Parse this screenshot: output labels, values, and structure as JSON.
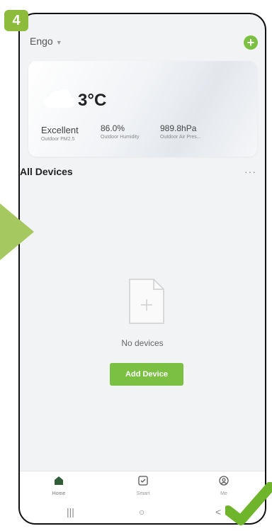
{
  "step": "4",
  "header": {
    "title": "Engo"
  },
  "weather": {
    "temperature": "3°C",
    "stats": [
      {
        "value": "Excellent",
        "label": "Outdoor PM2.5"
      },
      {
        "value": "86.0%",
        "label": "Outdoor Humidity"
      },
      {
        "value": "989.8hPa",
        "label": "Outdoor Air Pres..."
      }
    ]
  },
  "devices": {
    "title": "All Devices",
    "more": "···",
    "empty_text": "No devices",
    "add_button": "Add Device"
  },
  "tabs": [
    {
      "label": "Home",
      "icon": "home-icon"
    },
    {
      "label": "Smart",
      "icon": "smart-icon"
    },
    {
      "label": "Me",
      "icon": "user-icon"
    }
  ],
  "sysnav": {
    "recents": "|||",
    "home": "○",
    "back": "<"
  },
  "colors": {
    "accent": "#7bc043",
    "arrow": "#a6c860",
    "badge": "#8dbb3c"
  }
}
